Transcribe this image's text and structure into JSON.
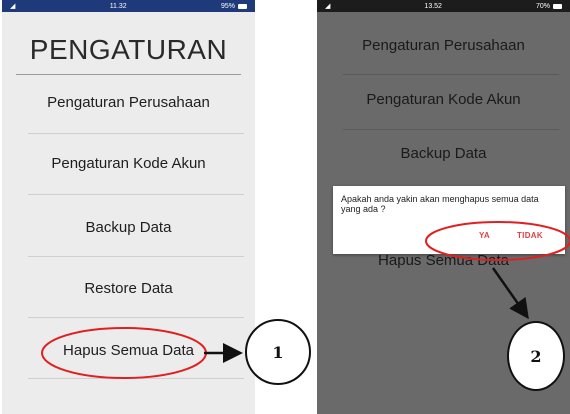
{
  "left_phone": {
    "status_time": "11.32",
    "status_right": "95%",
    "title": "PENGATURAN",
    "menu": [
      "Pengaturan Perusahaan",
      "Pengaturan Kode Akun",
      "Backup Data",
      "Restore Data",
      "Hapus Semua Data"
    ]
  },
  "right_phone": {
    "status_time": "13.52",
    "status_right": "70%",
    "menu": [
      "Pengaturan Perusahaan",
      "Pengaturan Kode Akun",
      "Backup Data",
      "Hapus Semua Data"
    ],
    "dialog": {
      "message": "Apakah anda yakin akan menghapus semua data yang ada ?",
      "yes_label": "YA",
      "no_label": "TIDAK"
    }
  },
  "callouts": {
    "step1": "1",
    "step2": "2"
  },
  "colors": {
    "highlight": "#e02020",
    "dialog_button": "#e04040"
  }
}
